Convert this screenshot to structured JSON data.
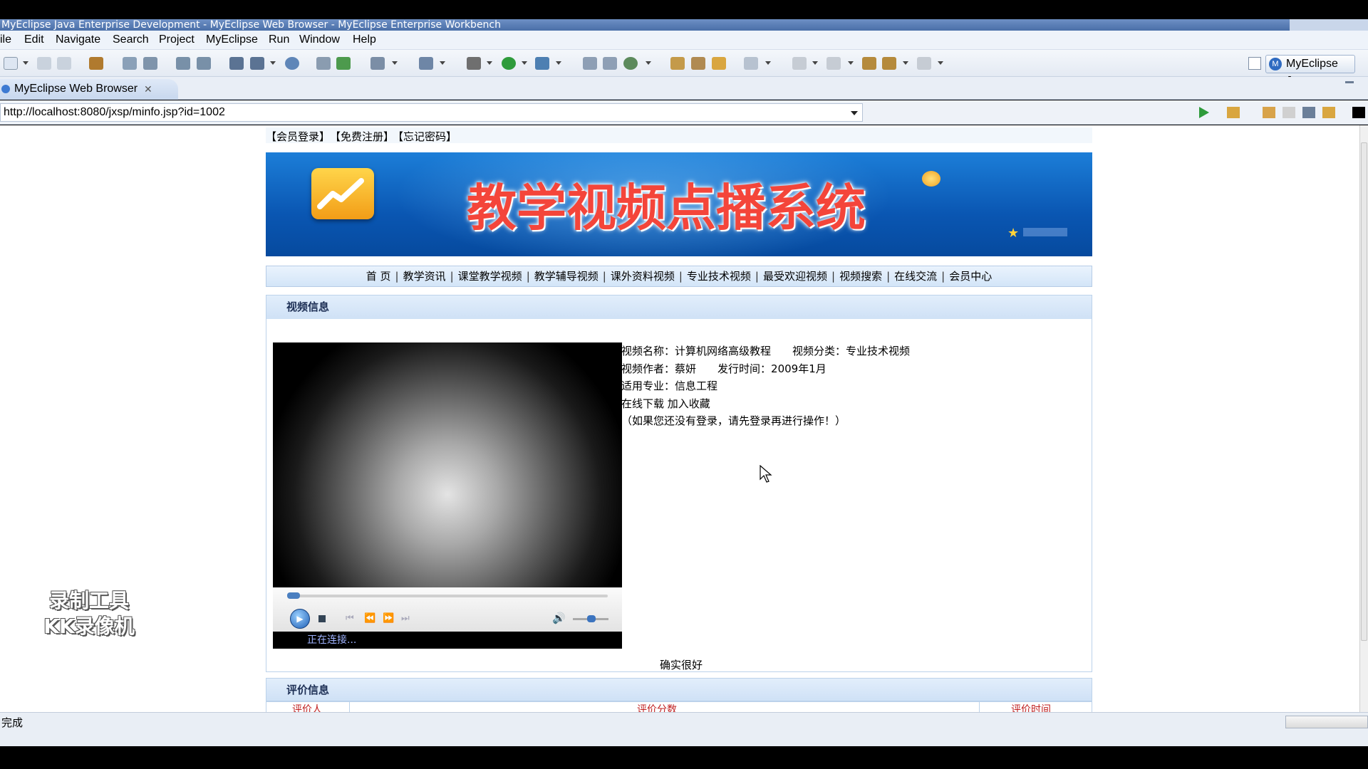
{
  "window": {
    "title": "MyEclipse Java Enterprise Development - MyEclipse Web Browser - MyEclipse Enterprise Workbench"
  },
  "menubar": {
    "items": [
      "ile",
      "Edit",
      "Navigate",
      "Search",
      "Project",
      "MyEclipse",
      "Run",
      "Window",
      "Help"
    ]
  },
  "toolbar": {
    "perspective_label": "MyEclipse J..."
  },
  "tab": {
    "label": "MyEclipse Web Browser",
    "close": "✕"
  },
  "address": {
    "url": "http://localhost:8080/jxsp/minfo.jsp?id=1002"
  },
  "page": {
    "top_links": [
      "【会员登录】",
      "【免费注册】",
      "【忘记密码】"
    ],
    "banner_title": "教学视频点播系统",
    "nav": [
      "首 页",
      "教学资讯",
      "课堂教学视频",
      "教学辅导视频",
      "课外资料视频",
      "专业技术视频",
      "最受欢迎视频",
      "视频搜索",
      "在线交流",
      "会员中心"
    ],
    "nav_sep": "|",
    "video_panel_title": "视频信息",
    "player_status": "正在连接...",
    "info": {
      "name_label": "视频名称：",
      "name_value": "计算机网络高级教程",
      "category_label": "视频分类：",
      "category_value": "专业技术视频",
      "author_label": "视频作者：",
      "author_value": "蔡妍",
      "release_label": "发行时间：",
      "release_value": "2009年1月",
      "major_label": "适用专业：",
      "major_value": "信息工程",
      "download": "在线下载",
      "favorite": "加入收藏",
      "notice": "（如果您还没有登录，请先登录再进行操作！）"
    },
    "comment": "确实很好",
    "review_panel_title": "评价信息",
    "review_columns": [
      "评价人",
      "评价分数",
      "评价时间"
    ]
  },
  "watermark": {
    "line1": "录制工具",
    "line2": "KK录像机"
  },
  "statusbar": {
    "text": "完成"
  }
}
